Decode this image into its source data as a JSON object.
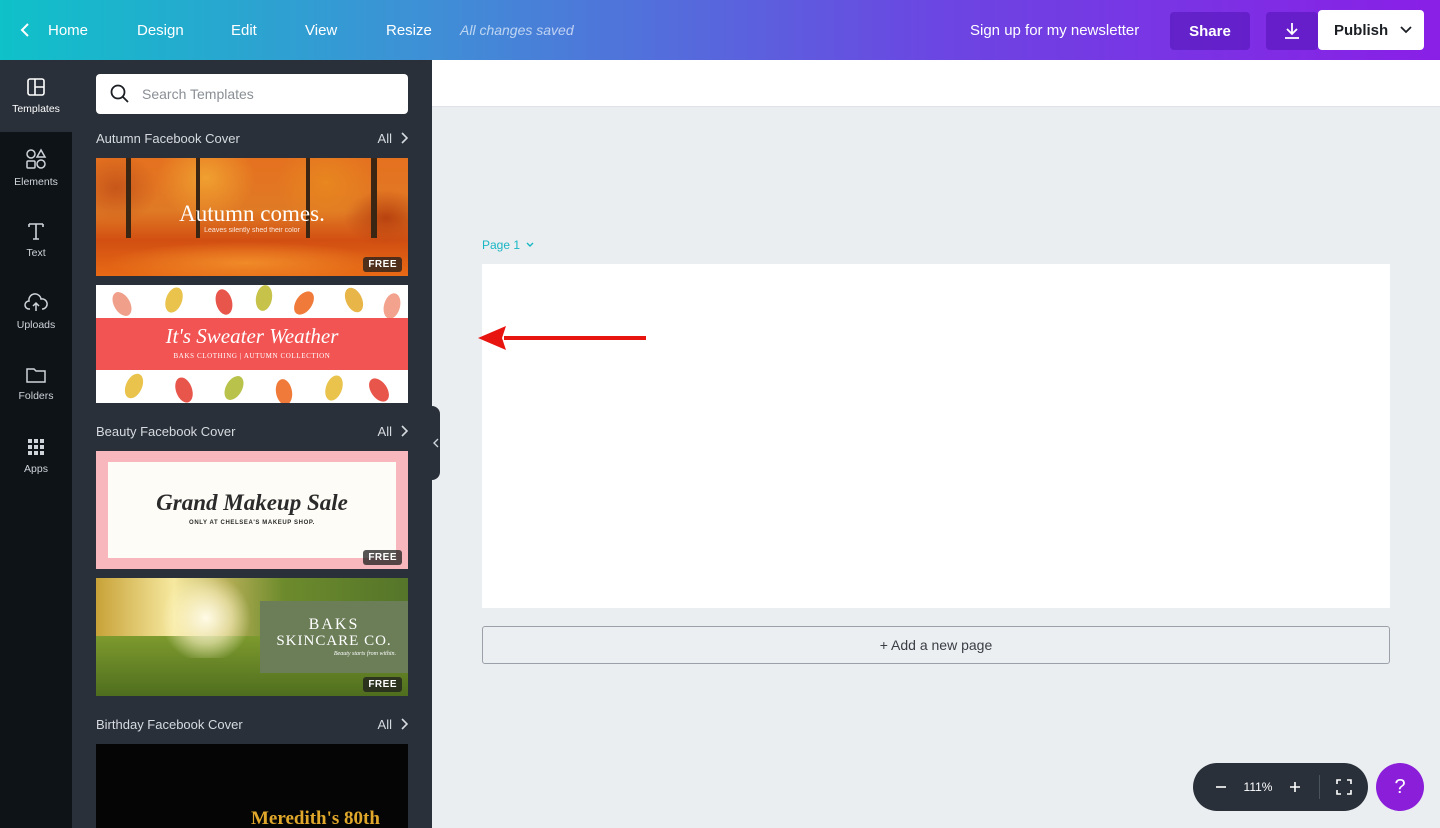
{
  "topbar": {
    "home": "Home",
    "design": "Design",
    "edit": "Edit",
    "view": "View",
    "resize": "Resize",
    "saved_status": "All changes saved",
    "doc_title": "Sign up for my newsletter",
    "share": "Share",
    "publish": "Publish"
  },
  "rail": {
    "templates": "Templates",
    "elements": "Elements",
    "text": "Text",
    "uploads": "Uploads",
    "folders": "Folders",
    "apps": "Apps"
  },
  "panel": {
    "search_placeholder": "Search Templates",
    "all_label": "All",
    "free_badge": "FREE",
    "sections": [
      {
        "title": "Autumn Facebook Cover",
        "templates": [
          {
            "title": "Autumn comes.",
            "subtitle": "Leaves silently shed their color",
            "free": true
          },
          {
            "title": "It's Sweater Weather",
            "subtitle": "BAKS CLOTHING | AUTUMN COLLECTION",
            "free": false
          }
        ]
      },
      {
        "title": "Beauty Facebook Cover",
        "templates": [
          {
            "title": "Grand Makeup Sale",
            "subtitle": "ONLY AT CHELSEA'S MAKEUP SHOP.",
            "free": true
          },
          {
            "title_line1": "BAKS",
            "title_line2": "SKINCARE CO.",
            "subtitle": "Beauty starts from within.",
            "free": true
          }
        ]
      },
      {
        "title": "Birthday Facebook Cover",
        "templates": [
          {
            "title": "Meredith's 80th"
          }
        ]
      }
    ]
  },
  "canvas": {
    "page_label": "Page 1",
    "add_page": "+ Add a new page"
  },
  "zoom": {
    "value": "111%"
  },
  "help": "?",
  "colors": {
    "accent_teal": "#19b6c3",
    "help_purple": "#8b1fd9",
    "annotation_arrow": "#e8140f"
  }
}
